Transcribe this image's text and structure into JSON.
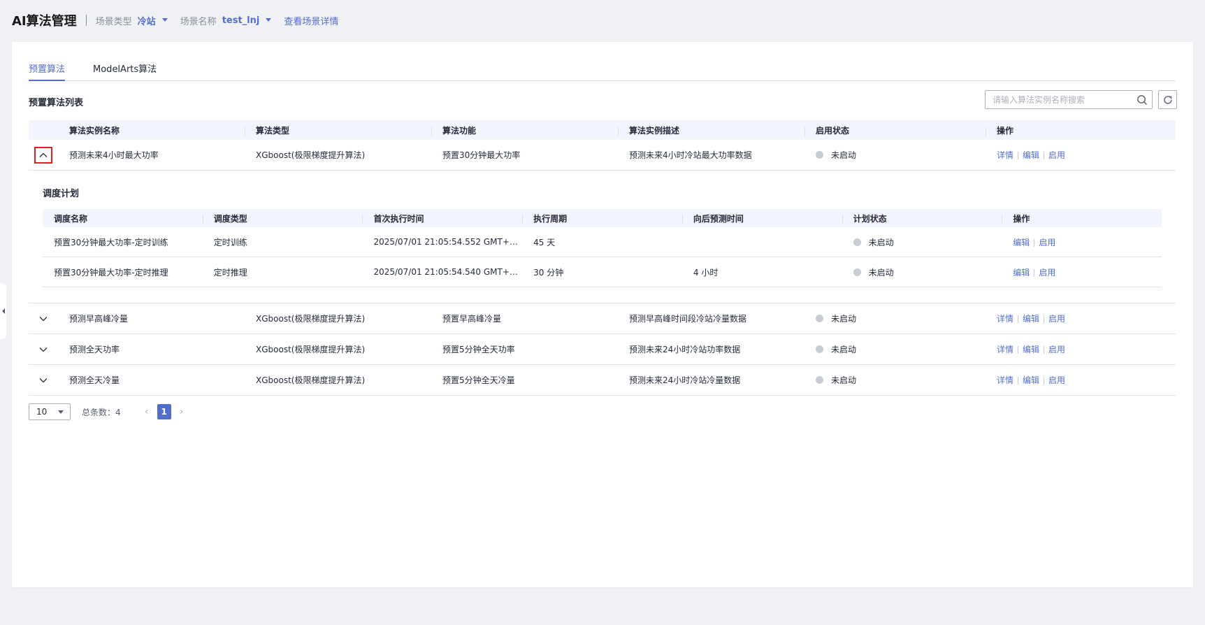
{
  "header": {
    "title": "AI算法管理",
    "scene_type_label": "场景类型",
    "scene_type_value": "冷站",
    "scene_name_label": "场景名称",
    "scene_name_value": "test_lnj",
    "view_detail_link": "查看场景详情"
  },
  "tabs": [
    {
      "label": "预置算法",
      "active": true
    },
    {
      "label": "ModelArts算法",
      "active": false
    }
  ],
  "section_title": "预置算法列表",
  "search": {
    "placeholder": "请输入算法实例名称搜索"
  },
  "table": {
    "columns": [
      "算法实例名称",
      "算法类型",
      "算法功能",
      "算法实例描述",
      "启用状态",
      "操作"
    ],
    "rows": [
      {
        "name": "预测未来4小时最大功率",
        "type": "XGboost(极限梯度提升算法)",
        "func": "预置30分钟最大功率",
        "desc": "预测未来4小时冷站最大功率数据",
        "status": "未启动",
        "expanded": true
      },
      {
        "name": "预测早高峰冷量",
        "type": "XGboost(极限梯度提升算法)",
        "func": "预置早高峰冷量",
        "desc": "预测早高峰时间段冷站冷量数据",
        "status": "未启动",
        "expanded": false
      },
      {
        "name": "预测全天功率",
        "type": "XGboost(极限梯度提升算法)",
        "func": "预置5分钟全天功率",
        "desc": "预测未来24小时冷站功率数据",
        "status": "未启动",
        "expanded": false
      },
      {
        "name": "预测全天冷量",
        "type": "XGboost(极限梯度提升算法)",
        "func": "预置5分钟全天冷量",
        "desc": "预测未来24小时冷站冷量数据",
        "status": "未启动",
        "expanded": false
      }
    ],
    "ops": {
      "detail": "详情",
      "edit": "编辑",
      "enable": "启用"
    }
  },
  "schedule": {
    "title": "调度计划",
    "columns": [
      "调度名称",
      "调度类型",
      "首次执行时间",
      "执行周期",
      "向后预测时间",
      "计划状态",
      "操作"
    ],
    "rows": [
      {
        "name": "预置30分钟最大功率-定时训练",
        "type": "定时训练",
        "first_time": "2025/07/01 21:05:54.552 GMT+08...",
        "period": "45 天",
        "predict": "",
        "status": "未启动"
      },
      {
        "name": "预置30分钟最大功率-定时推理",
        "type": "定时推理",
        "first_time": "2025/07/01 21:05:54.540 GMT+08...",
        "period": "30 分钟",
        "predict": "4 小时",
        "status": "未启动"
      }
    ],
    "ops": {
      "edit": "编辑",
      "enable": "启用"
    }
  },
  "pagination": {
    "page_size": "10",
    "total_text": "总条数：4",
    "current_page": "1"
  },
  "colors": {
    "accent": "#526ecc",
    "status_dot": "#c8ccd4",
    "highlight_border": "#e02020"
  }
}
